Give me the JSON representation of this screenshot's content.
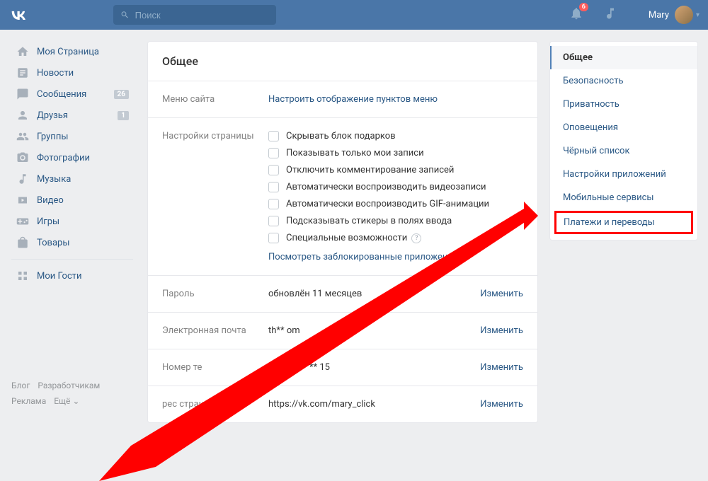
{
  "header": {
    "search_placeholder": "Поиск",
    "notif_count": "6",
    "user_name": "Mary"
  },
  "sidebar": {
    "items": [
      {
        "label": "Моя Страница",
        "badge": null
      },
      {
        "label": "Новости",
        "badge": null
      },
      {
        "label": "Сообщения",
        "badge": "26"
      },
      {
        "label": "Друзья",
        "badge": "1"
      },
      {
        "label": "Группы",
        "badge": null
      },
      {
        "label": "Фотографии",
        "badge": null
      },
      {
        "label": "Музыка",
        "badge": null
      },
      {
        "label": "Видео",
        "badge": null
      },
      {
        "label": "Игры",
        "badge": null
      },
      {
        "label": "Товары",
        "badge": null
      }
    ],
    "guests": "Мои Гости"
  },
  "footer": {
    "blog": "Блог",
    "dev": "Разработчикам",
    "ads": "Реклама",
    "more": "Ещё ⌄"
  },
  "content": {
    "title": "Общее",
    "menu_row": {
      "label": "Меню сайта",
      "link": "Настроить отображение пунктов меню"
    },
    "page_settings": {
      "label": "Настройки страницы",
      "checks": [
        "Скрывать блок подарков",
        "Показывать только мои записи",
        "Отключить комментирование записей",
        "Автоматически воспроизводить видеозаписи",
        "Автоматически воспроизводить GIF-анимации",
        "Подсказывать стикеры в полях ввода",
        "Специальные возможности"
      ],
      "blocked_link": "Посмотреть заблокированные приложен"
    },
    "password": {
      "label": "Пароль",
      "value": "обновлён 11 месяцев",
      "action": "Изменить"
    },
    "email": {
      "label": "Электронная почта",
      "value": "th**            om",
      "action": "Изменить"
    },
    "phone": {
      "label": "Номер те",
      "value": "+7 *** *** ** 15",
      "action": "Изменить"
    },
    "address": {
      "label": "рес страницы",
      "value": "https://vk.com/mary_click",
      "action": "Изменить"
    }
  },
  "rpanel": {
    "items": [
      "Общее",
      "Безопасность",
      "Приватность",
      "Оповещения",
      "Чёрный список",
      "Настройки приложений",
      "Мобильные сервисы",
      "Платежи и переводы"
    ]
  }
}
